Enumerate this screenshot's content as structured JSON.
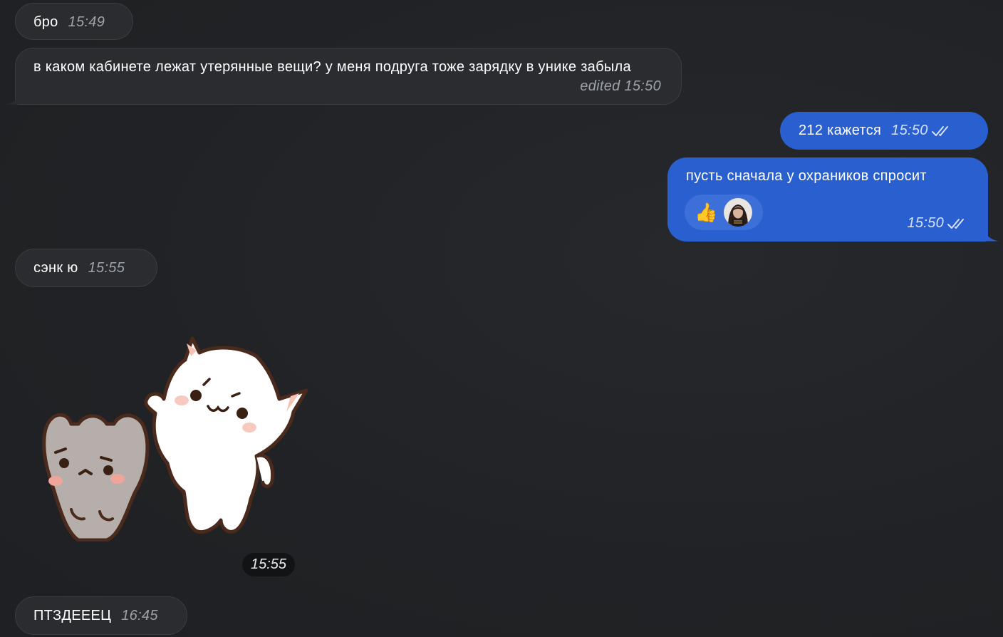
{
  "messages": [
    {
      "text": "бро",
      "time": "15:49",
      "direction": "incoming"
    },
    {
      "text": "в каком кабинете лежат утерянные вещи? у меня подруга тоже зарядку в унике забыла",
      "time": "edited 15:50",
      "direction": "incoming"
    },
    {
      "text": "212 кажется",
      "time": "15:50",
      "direction": "outgoing",
      "status": "read"
    },
    {
      "text": "пусть сначала у охраников спросит",
      "time": "15:50",
      "direction": "outgoing",
      "status": "read",
      "reaction_emoji": "👍"
    },
    {
      "text": "сэнк ю",
      "time": "15:55",
      "direction": "incoming"
    },
    {
      "sticker": "two-cats-sticker",
      "time": "15:55",
      "direction": "incoming"
    },
    {
      "text": "ПТЗДЕЕЕЦ",
      "time": "16:45",
      "direction": "incoming"
    }
  ],
  "colors": {
    "background": "#212326",
    "incoming_bubble": "#2a2c30",
    "outgoing_bubble": "#2a5fd0",
    "reaction_pill": "#3d6fd8"
  }
}
